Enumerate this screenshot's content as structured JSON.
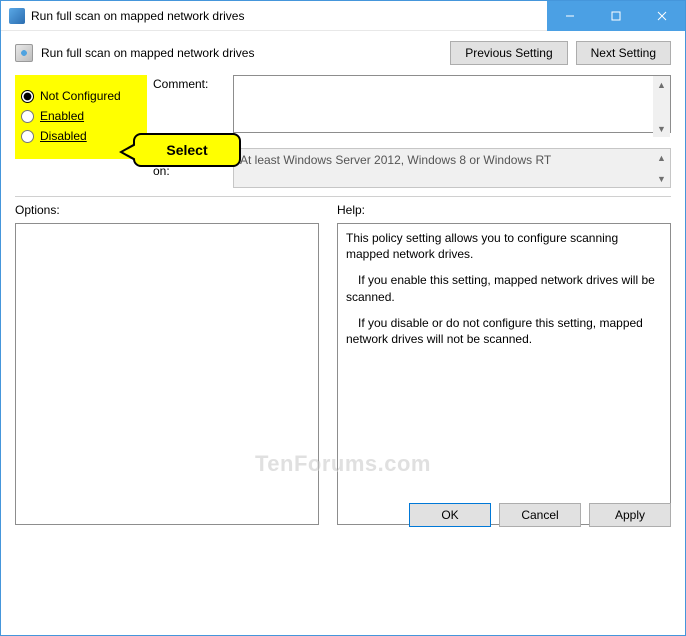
{
  "window": {
    "title": "Run full scan on mapped network drives"
  },
  "header": {
    "policy_title": "Run full scan on mapped network drives",
    "previous_setting": "Previous Setting",
    "next_setting": "Next Setting"
  },
  "state": {
    "not_configured": "Not Configured",
    "enabled": "Enabled",
    "disabled": "Disabled",
    "selected": "not_configured"
  },
  "labels": {
    "comment": "Comment:",
    "supported_on": "Supported on:",
    "options": "Options:",
    "help": "Help:"
  },
  "fields": {
    "comment_value": "",
    "supported_on_value": "At least Windows Server 2012, Windows 8 or Windows RT"
  },
  "help": {
    "p1": "This policy setting allows you to configure scanning mapped network drives.",
    "p2": "If you enable this setting, mapped network drives will be scanned.",
    "p3": "If you disable or do not configure this setting, mapped network drives will not be scanned."
  },
  "buttons": {
    "ok": "OK",
    "cancel": "Cancel",
    "apply": "Apply"
  },
  "annotation": {
    "select": "Select"
  },
  "watermark": "TenForums.com"
}
